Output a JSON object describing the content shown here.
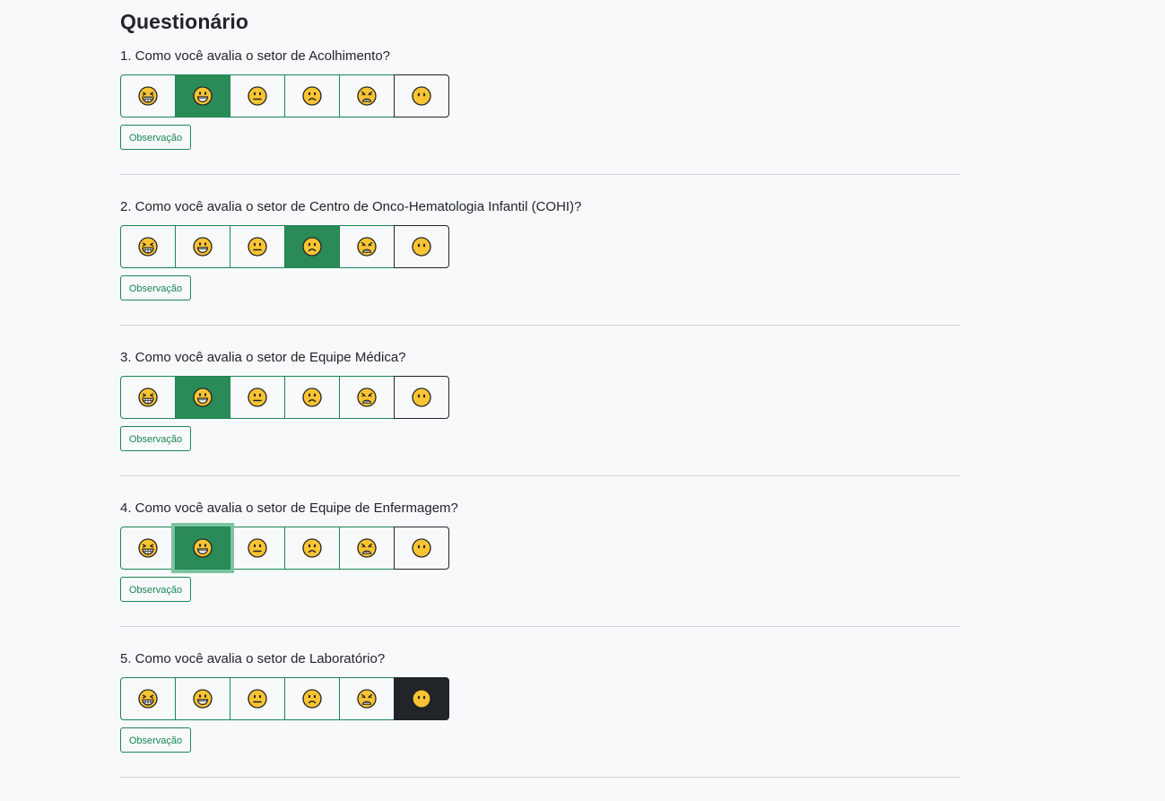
{
  "page": {
    "title": "Questionário"
  },
  "rating_icons": [
    "grinning-squinting-face-icon",
    "grinning-face-icon",
    "neutral-face-icon",
    "slightly-frowning-face-icon",
    "weary-face-icon",
    "face-without-mouth-icon"
  ],
  "observation_label": "Observação",
  "questions": [
    {
      "text": "1. Como você avalia o setor de Acolhimento?",
      "selected_index": 1,
      "selected_style": "green",
      "focused": false
    },
    {
      "text": "2. Como você avalia o setor de Centro de Onco-Hematologia Infantil (COHI)?",
      "selected_index": 3,
      "selected_style": "green",
      "focused": false
    },
    {
      "text": "3. Como você avalia o setor de Equipe Médica?",
      "selected_index": 1,
      "selected_style": "green",
      "focused": false
    },
    {
      "text": "4. Como você avalia o setor de Equipe de Enfermagem?",
      "selected_index": 1,
      "selected_style": "green",
      "focused": true
    },
    {
      "text": "5. Como você avalia o setor de Laboratório?",
      "selected_index": 5,
      "selected_style": "dark",
      "focused": false
    }
  ],
  "colors": {
    "accent": "#198754",
    "dark": "#212529",
    "background": "#f8f9fa",
    "emoji_fill": "#f9c433"
  }
}
